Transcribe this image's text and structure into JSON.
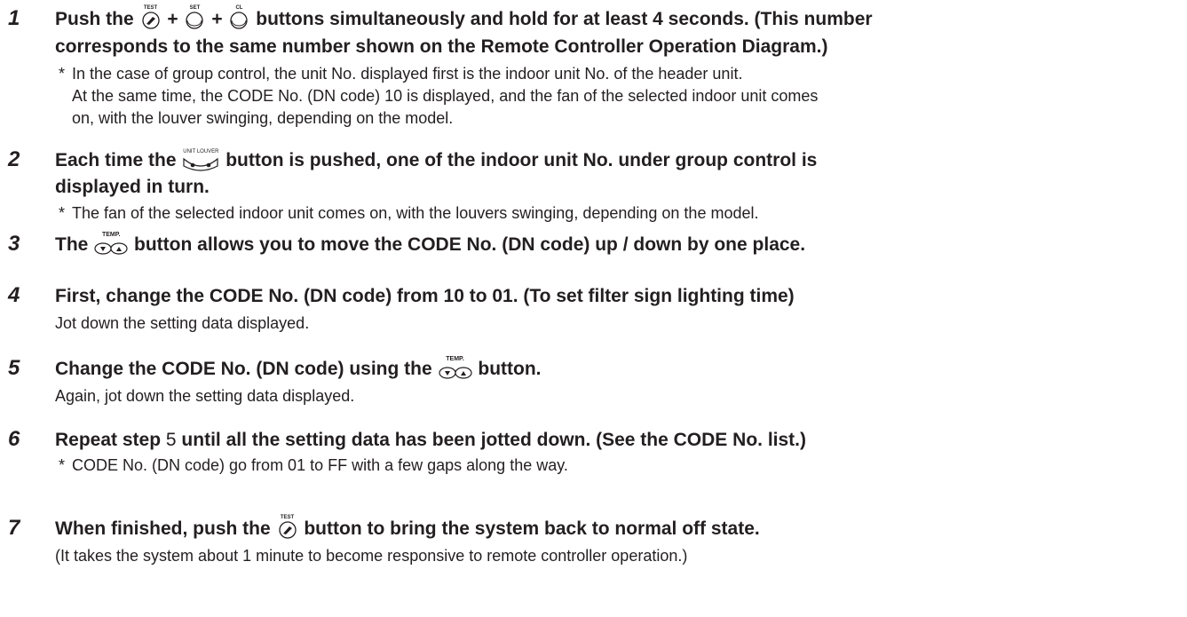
{
  "steps": [
    {
      "num": "1",
      "title_a": "Push the",
      "plus": "+",
      "title_b": "buttons simultaneously and hold for at least 4 seconds. (This number",
      "title_c": "corresponds to the same number shown on the Remote Controller Operation Diagram.)",
      "icon_test_label": "TEST",
      "icon_set_label": "SET",
      "icon_cl_label": "CL",
      "note_star": "*",
      "note_1": "In the case of group control, the unit No. displayed first is the indoor unit No. of the header unit.",
      "note_2": "At the same time, the CODE No. (DN code) 10 is displayed, and the fan of the selected indoor unit comes",
      "note_3": "on, with the louver swinging, depending on the model."
    },
    {
      "num": "2",
      "title_a": "Each time the",
      "icon_label": "UNIT LOUVER",
      "title_b": "button is pushed, one of the indoor unit No. under group control is",
      "title_c": "displayed in turn.",
      "note_star": "*",
      "note_1": "The fan of the selected indoor unit comes on, with the louvers swinging, depending on the model."
    },
    {
      "num": "3",
      "title_a": "The",
      "icon_label": "TEMP.",
      "title_b": "button allows you to move the CODE No. (DN code) up / down by one place."
    },
    {
      "num": "4",
      "title_a": "First, change the CODE No. (DN code) from 10 to 01. (To set filter sign lighting time)",
      "line_1": "Jot down the setting data displayed."
    },
    {
      "num": "5",
      "title_a": "Change the CODE No. (DN code) using the",
      "icon_label": "TEMP.",
      "title_b": "button.",
      "line_1": "Again, jot down the setting data displayed."
    },
    {
      "num": "6",
      "title_a": "Repeat step",
      "title_num": "5",
      "title_b": "until all the setting data has been jotted down. (See the CODE No. list.)",
      "note_star": "*",
      "note_1": "CODE No. (DN code) go from 01 to FF with a few gaps along the way."
    },
    {
      "num": "7",
      "title_a": "When finished, push the",
      "icon_label": "TEST",
      "title_b": "button to bring the system back to normal off state.",
      "line_1": "(It takes the system about 1 minute to become responsive to remote controller operation.)"
    }
  ]
}
